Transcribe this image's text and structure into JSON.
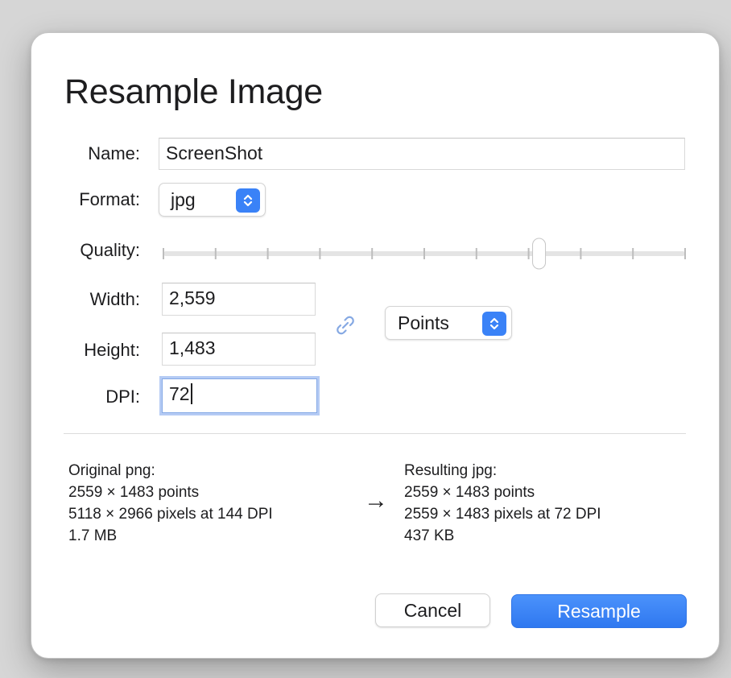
{
  "dialog": {
    "title": "Resample Image"
  },
  "form": {
    "name_label": "Name:",
    "name_value": "ScreenShot",
    "format_label": "Format:",
    "format_value": "jpg",
    "quality_label": "Quality:",
    "quality_value": 0.72,
    "quality_tick_count": 11,
    "width_label": "Width:",
    "width_value": "2,559",
    "height_label": "Height:",
    "height_value": "1,483",
    "dpi_label": "DPI:",
    "dpi_value": "72",
    "units_value": "Points"
  },
  "icons": {
    "link": "link-chain-icon",
    "stepper": "updown-chevron-icon",
    "arrow": "right-arrow-icon"
  },
  "summary": {
    "original": {
      "heading": "Original png:",
      "points": "2559 × 1483 points",
      "pixels": "5118 × 2966 pixels at 144 DPI",
      "size": "1.7 MB"
    },
    "arrow": "→",
    "result": {
      "heading": "Resulting jpg:",
      "points": "2559 × 1483 points",
      "pixels": "2559 × 1483 pixels at 72 DPI",
      "size": "437 KB"
    }
  },
  "buttons": {
    "cancel": "Cancel",
    "resample": "Resample"
  },
  "colors": {
    "accent": "#3a82f7",
    "focus_ring": "#84a9e6"
  }
}
